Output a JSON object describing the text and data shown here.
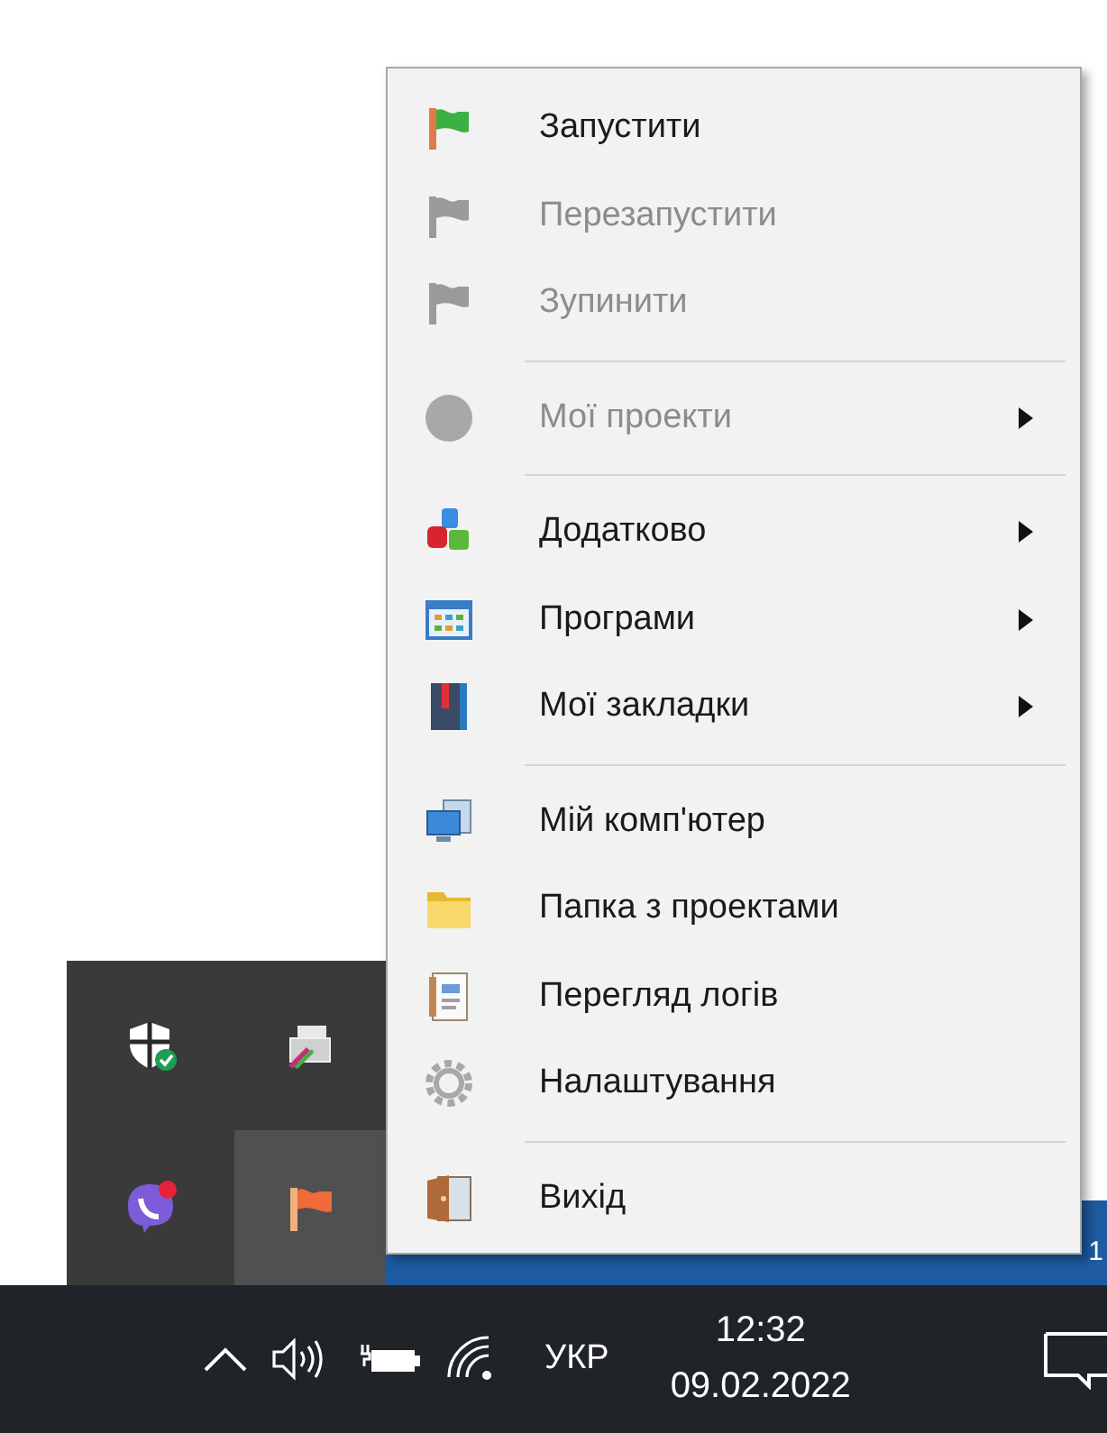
{
  "menu": {
    "items": [
      {
        "kind": "flag",
        "label": "Запустити",
        "disabled": false,
        "submenu": false
      },
      {
        "kind": "flag",
        "label": "Перезапустити",
        "disabled": true,
        "submenu": false
      },
      {
        "kind": "flag",
        "label": "Зупинити",
        "disabled": true,
        "submenu": false
      },
      {
        "kind": "separator"
      },
      {
        "kind": "circle",
        "label": "Мої проекти",
        "disabled": true,
        "submenu": true
      },
      {
        "kind": "separator"
      },
      {
        "kind": "blocks",
        "label": "Додатково",
        "disabled": false,
        "submenu": true
      },
      {
        "kind": "window-grid",
        "label": "Програми",
        "disabled": false,
        "submenu": true
      },
      {
        "kind": "book",
        "label": "Мої закладки",
        "disabled": false,
        "submenu": true
      },
      {
        "kind": "separator"
      },
      {
        "kind": "computer",
        "label": "Мій комп'ютер",
        "disabled": false,
        "submenu": false
      },
      {
        "kind": "folder",
        "label": "Папка з проектами",
        "disabled": false,
        "submenu": false
      },
      {
        "kind": "log",
        "label": "Перегляд логів",
        "disabled": false,
        "submenu": false
      },
      {
        "kind": "gear",
        "label": "Налаштування",
        "disabled": false,
        "submenu": false
      },
      {
        "kind": "separator"
      },
      {
        "kind": "door",
        "label": "Вихід",
        "disabled": false,
        "submenu": false
      }
    ]
  },
  "tray_overflow": {
    "icons": [
      {
        "kind": "shield",
        "selected": false
      },
      {
        "kind": "printer",
        "selected": false
      },
      {
        "kind": "chat",
        "selected": false
      },
      {
        "kind": "flag",
        "selected": true
      }
    ]
  },
  "desktop_edge_text": "1",
  "taskbar": {
    "language": "УКР",
    "time": "12:32",
    "date": "09.02.2022"
  }
}
